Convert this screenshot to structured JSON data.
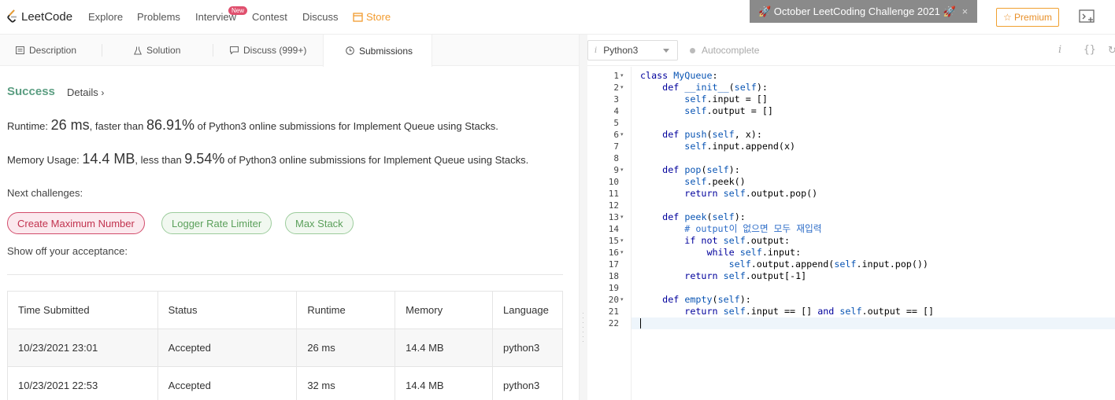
{
  "nav": {
    "logo_text": "LeetCode",
    "items": [
      "Explore",
      "Problems",
      "Interview",
      "Contest",
      "Discuss",
      "Store"
    ],
    "new_badge": "New",
    "banner_text": "🚀 October LeetCoding Challenge 2021 🚀",
    "banner_close": "×",
    "premium_label": "☆ Premium"
  },
  "left_tabs": [
    "Description",
    "Solution",
    "Discuss (999+)",
    "Submissions"
  ],
  "result": {
    "status": "Success",
    "details": "Details",
    "runtime_prefix": "Runtime: ",
    "runtime_value": "26 ms",
    "runtime_mid": ", faster than ",
    "runtime_pct": "86.91%",
    "runtime_suffix": " of Python3 online submissions for Implement Queue using Stacks.",
    "memory_prefix": "Memory Usage: ",
    "memory_value": "14.4 MB",
    "memory_mid": ", less than ",
    "memory_pct": "9.54%",
    "memory_suffix": " of Python3 online submissions for Implement Queue using Stacks.",
    "next_label": "Next challenges:",
    "challenges": [
      "Create Maximum Number",
      "Logger Rate Limiter",
      "Max Stack"
    ],
    "show_off": "Show off your acceptance:"
  },
  "table": {
    "headers": [
      "Time Submitted",
      "Status",
      "Runtime",
      "Memory",
      "Language"
    ],
    "rows": [
      [
        "10/23/2021 23:01",
        "Accepted",
        "26 ms",
        "14.4 MB",
        "python3"
      ],
      [
        "10/23/2021 22:53",
        "Accepted",
        "32 ms",
        "14.4 MB",
        "python3"
      ]
    ]
  },
  "editor": {
    "language": "Python3",
    "autocomplete": "Autocomplete",
    "info_icon": "i",
    "braces_icon": "{}",
    "line_numbers": [
      "1",
      "2",
      "3",
      "4",
      "5",
      "6",
      "7",
      "8",
      "9",
      "10",
      "11",
      "12",
      "13",
      "14",
      "15",
      "16",
      "17",
      "18",
      "19",
      "20",
      "21",
      "22"
    ],
    "fold_lines": [
      "1",
      "2",
      "6",
      "9",
      "13",
      "15",
      "16",
      "20"
    ]
  },
  "colors": {
    "accent": "#5c9e82",
    "store": "#f29b2e",
    "premium": "#e8902a",
    "challenge_red": "#c2334f",
    "challenge_green": "#5ba05b"
  }
}
